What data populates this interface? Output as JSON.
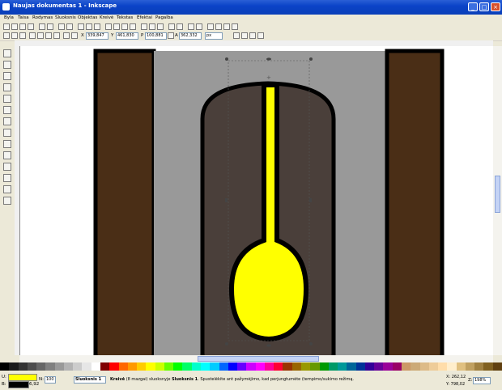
{
  "window": {
    "title": "Naujas dokumentas 1 - Inkscape",
    "minimize": "_",
    "maximize": "□",
    "close": "×"
  },
  "menu": [
    "Byla",
    "Taisa",
    "Rodymas",
    "Sluoksnis",
    "Objektas",
    "Kreivė",
    "Tekstas",
    "Efektai",
    "Pagalba"
  ],
  "controls": {
    "x_label": "X",
    "x_value": "339,847",
    "y_label": "Y",
    "y_value": "461,830",
    "w_label": "P",
    "w_value": "100,881",
    "h_label": "A",
    "h_value": "362,332",
    "unit": "px"
  },
  "status": {
    "fill_label": "U:",
    "stroke_label": "B:",
    "stroke_width": "6,92",
    "opacity_label": "N:",
    "opacity_value": "100",
    "layer": "Sluoksnis 1",
    "message_bold_1": "Kreivė",
    "message_part_1": " (8 mazgai) sluoksnyje ",
    "message_bold_2": "Sluoksnis 1",
    "message_part_2": ". Spustelėkite ant pažymėjimo, kad perjungtumėte (tempimo/sukimo režimą.",
    "x_coord": "X: 262,12",
    "y_coord": "Y: 798,02",
    "zoom_label": "Z:",
    "zoom_value": "198%"
  },
  "colors": {
    "accent": "#0b43c8",
    "brown": "#4a2e16",
    "gray": "#999999",
    "dark": "#4a3f3a",
    "yellow": "#ffff00",
    "black": "#000000"
  }
}
